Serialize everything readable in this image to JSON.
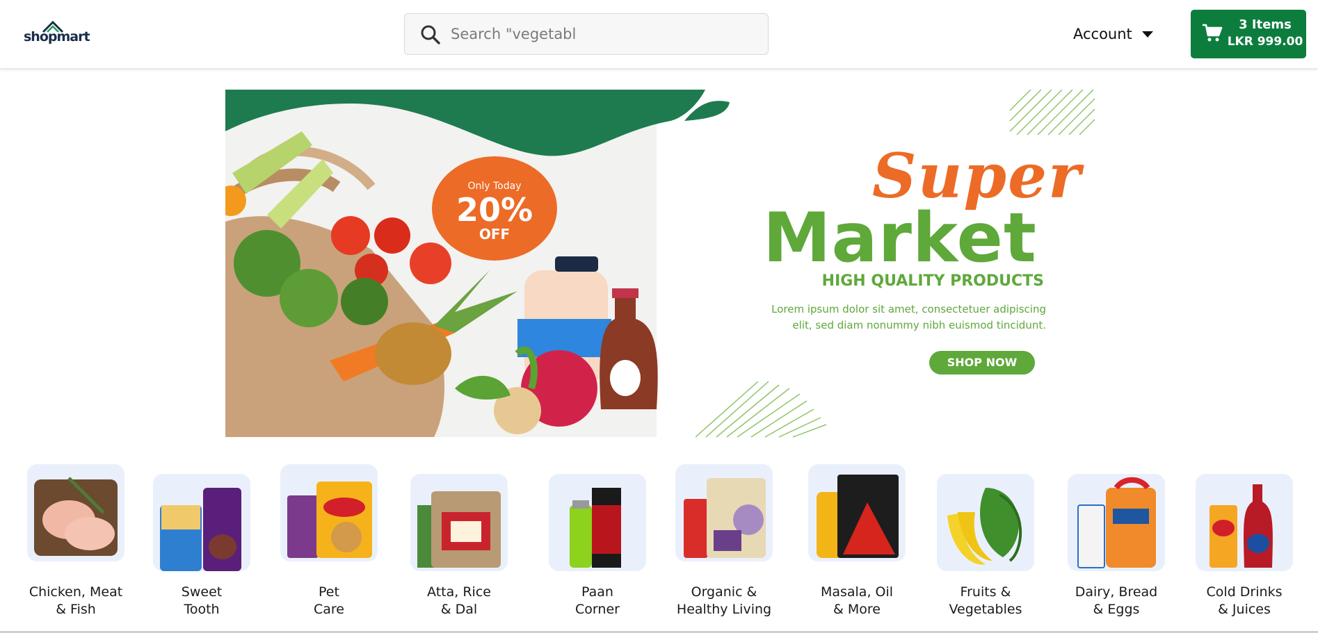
{
  "header": {
    "logo_text": "shopmart",
    "search": {
      "placeholder": "Search \"vegetabl"
    },
    "account_label": "Account",
    "cart": {
      "items": "3 Items",
      "total": "LKR 999.00"
    }
  },
  "banner": {
    "badge": {
      "small": "Only Today",
      "big": "20%",
      "off": "OFF"
    },
    "title_top": "Super",
    "title_main": "Market",
    "subtitle": "HIGH QUALITY PRODUCTS",
    "body_line1": "Lorem ipsum dolor sit amet, consectetuer adipiscing",
    "body_line2": "elit, sed diam nonummy nibh euismod tincidunt.",
    "cta": "SHOP NOW",
    "colors": {
      "green_dark": "#1e7b4f",
      "green": "#5fa83a",
      "orange": "#ec6b27"
    }
  },
  "categories": [
    {
      "line1": "Chicken, Meat",
      "line2": "& Fish",
      "icon": "chicken-meat-icon"
    },
    {
      "line1": "Sweet",
      "line2": "Tooth",
      "icon": "ice-cream-chocolate-icon"
    },
    {
      "line1": "Pet",
      "line2": "Care",
      "icon": "pet-food-icon"
    },
    {
      "line1": "Atta, Rice",
      "line2": "& Dal",
      "icon": "atta-rice-icon"
    },
    {
      "line1": "Paan",
      "line2": "Corner",
      "icon": "lighter-paper-icon"
    },
    {
      "line1": "Organic &",
      "line2": "Healthy Living",
      "icon": "organic-pack-icon"
    },
    {
      "line1": "Masala, Oil",
      "line2": "& More",
      "icon": "masala-oil-icon"
    },
    {
      "line1": "Fruits &",
      "line2": "Vegetables",
      "icon": "fruits-vegetables-icon"
    },
    {
      "line1": "Dairy, Bread",
      "line2": "& Eggs",
      "icon": "dairy-bread-icon"
    },
    {
      "line1": "Cold Drinks",
      "line2": "& Juices",
      "icon": "cold-drinks-icon"
    }
  ]
}
